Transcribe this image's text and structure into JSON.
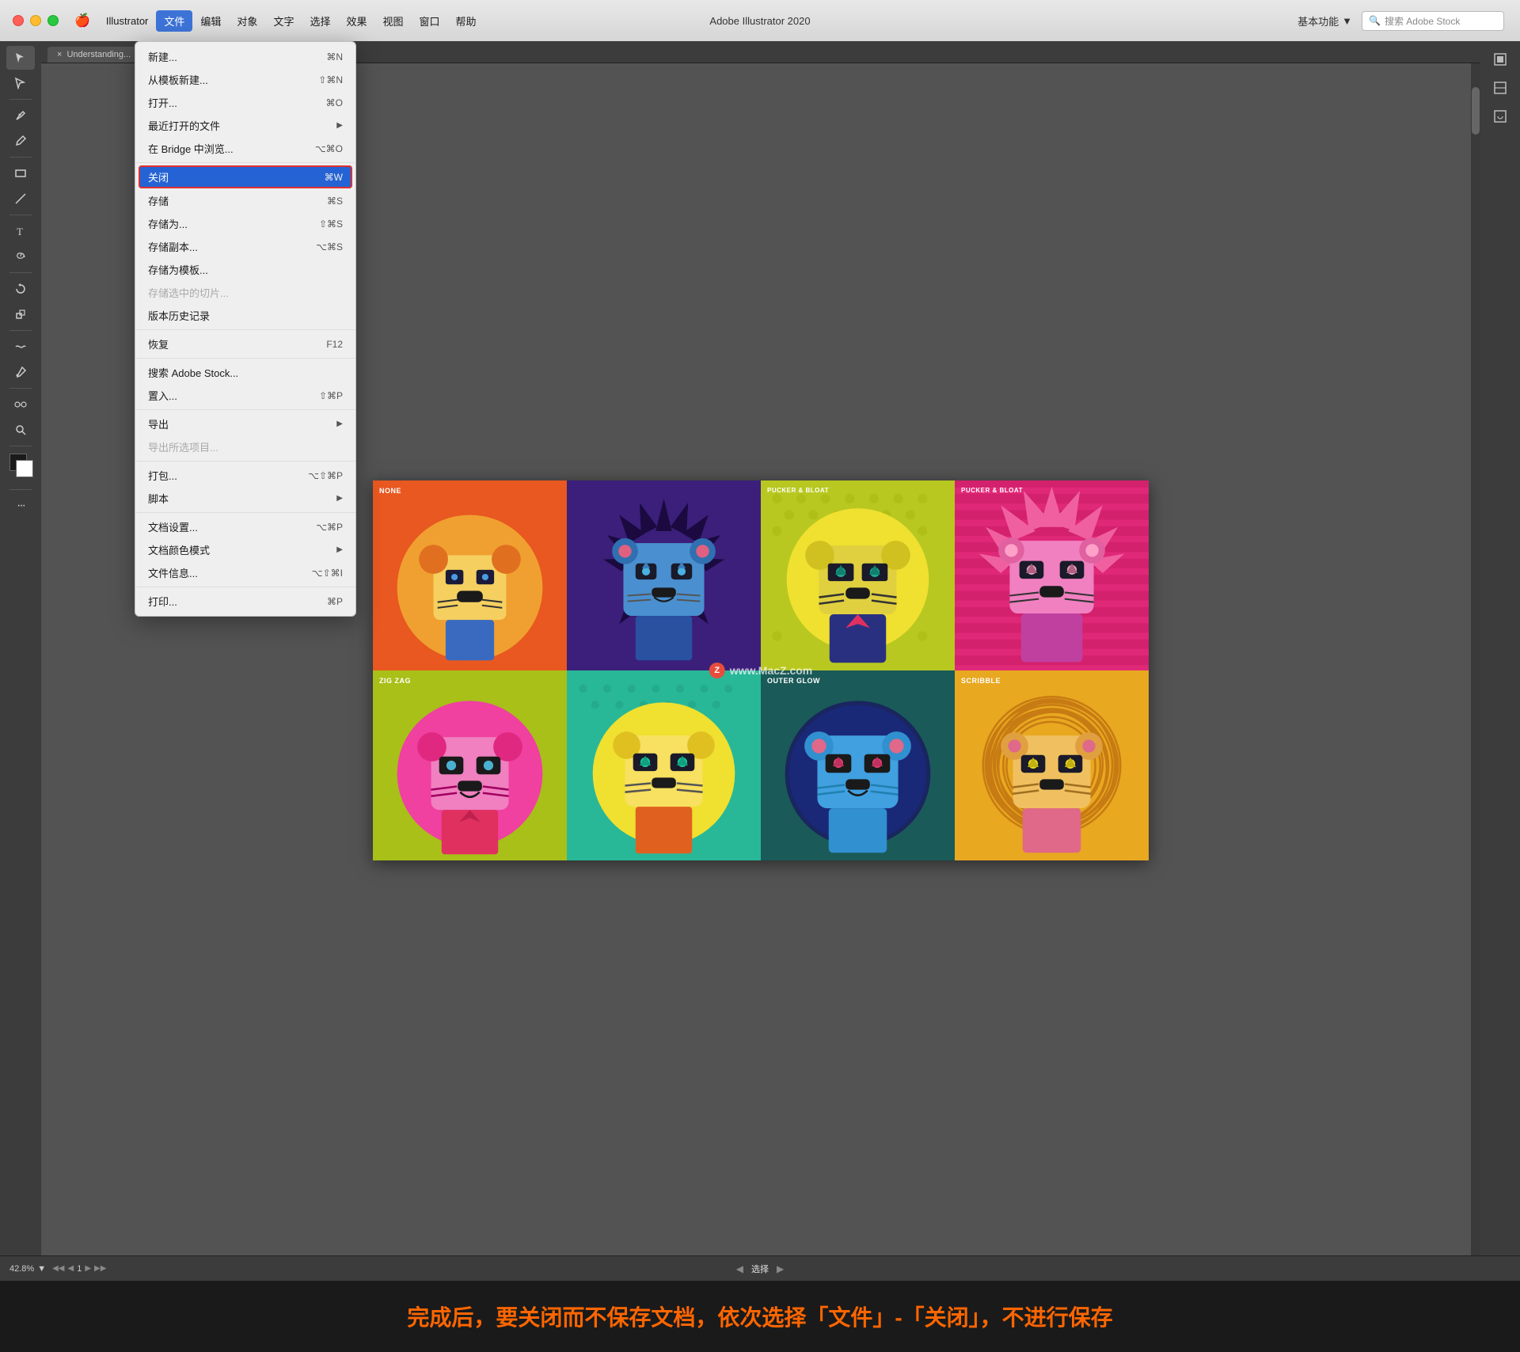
{
  "app": {
    "name": "Illustrator",
    "title": "Adobe Illustrator 2020",
    "apple_menu": "🍎"
  },
  "titlebar": {
    "menus": [
      "Illustrator",
      "文件",
      "编辑",
      "对象",
      "文字",
      "选择",
      "效果",
      "视图",
      "窗口",
      "帮助"
    ],
    "active_menu": "文件",
    "workspace": "基本功能",
    "search_placeholder": "搜索 Adobe Stock"
  },
  "file_menu": {
    "items": [
      {
        "label": "新建...",
        "shortcut": "⌘N",
        "type": "normal"
      },
      {
        "label": "从模板新建...",
        "shortcut": "⇧⌘N",
        "type": "normal"
      },
      {
        "label": "打开...",
        "shortcut": "⌘O",
        "type": "normal"
      },
      {
        "label": "最近打开的文件",
        "shortcut": "",
        "type": "submenu"
      },
      {
        "label": "在 Bridge 中浏览...",
        "shortcut": "⌥⌘O",
        "type": "normal"
      },
      {
        "label": "",
        "type": "separator"
      },
      {
        "label": "关闭",
        "shortcut": "⌘W",
        "type": "highlighted"
      },
      {
        "label": "存储",
        "shortcut": "⌘S",
        "type": "normal"
      },
      {
        "label": "存储为...",
        "shortcut": "⇧⌘S",
        "type": "normal"
      },
      {
        "label": "存储副本...",
        "shortcut": "⌥⌘S",
        "type": "normal"
      },
      {
        "label": "存储为模板...",
        "shortcut": "",
        "type": "normal"
      },
      {
        "label": "存储选中的切片...",
        "shortcut": "",
        "type": "disabled"
      },
      {
        "label": "版本历史记录",
        "shortcut": "",
        "type": "normal"
      },
      {
        "label": "",
        "type": "separator"
      },
      {
        "label": "恢复",
        "shortcut": "F12",
        "type": "normal"
      },
      {
        "label": "",
        "type": "separator"
      },
      {
        "label": "搜索 Adobe Stock...",
        "shortcut": "",
        "type": "normal"
      },
      {
        "label": "置入...",
        "shortcut": "⇧⌘P",
        "type": "normal"
      },
      {
        "label": "",
        "type": "separator"
      },
      {
        "label": "导出",
        "shortcut": "",
        "type": "submenu"
      },
      {
        "label": "导出所选项目...",
        "shortcut": "",
        "type": "disabled"
      },
      {
        "label": "",
        "type": "separator"
      },
      {
        "label": "打包...",
        "shortcut": "⌥⇧⌘P",
        "type": "normal"
      },
      {
        "label": "脚本",
        "shortcut": "",
        "type": "submenu"
      },
      {
        "label": "",
        "type": "separator"
      },
      {
        "label": "文档设置...",
        "shortcut": "⌥⌘P",
        "type": "normal"
      },
      {
        "label": "文档颜色模式",
        "shortcut": "",
        "type": "submenu"
      },
      {
        "label": "文件信息...",
        "shortcut": "⌥⇧⌘I",
        "type": "normal"
      },
      {
        "label": "",
        "type": "separator"
      },
      {
        "label": "打印...",
        "shortcut": "⌘P",
        "type": "normal"
      }
    ]
  },
  "doc_tab": {
    "name": "Understanding...",
    "close": "×"
  },
  "canvas": {
    "watermark": "www.MacZ.com"
  },
  "lion_cells": [
    {
      "id": "none",
      "label": "NONE",
      "bg": "#e85820",
      "label_color": "#fff"
    },
    {
      "id": "none2",
      "label": "",
      "bg": "#3b1f7a",
      "label_color": "#fff"
    },
    {
      "id": "pucker1",
      "label": "PUCKER & BLOAT",
      "bg": "#b8c820",
      "label_color": "#fff"
    },
    {
      "id": "pucker2",
      "label": "PUCKER & BLOAT",
      "bg": "#e02878",
      "label_color": "#fff"
    },
    {
      "id": "zigzag",
      "label": "ZIG ZAG",
      "bg": "#a8c018",
      "label_color": "#fff"
    },
    {
      "id": "zigzag2",
      "label": "",
      "bg": "#28b898",
      "label_color": "#fff"
    },
    {
      "id": "outer",
      "label": "OUTER GLOW",
      "bg": "#1a5a58",
      "label_color": "#fff"
    },
    {
      "id": "scribble",
      "label": "SCRIBBLE",
      "bg": "#e8a820",
      "label_color": "#fff"
    }
  ],
  "statusbar": {
    "zoom": "42.8%",
    "zoom_chevron": "▼",
    "page": "1",
    "status": "选择",
    "nav_prev_prev": "◀◀",
    "nav_prev": "◀",
    "nav_next": "▶",
    "nav_next_next": "▶▶"
  },
  "instruction": {
    "text": "完成后，要关闭而不保存文档，依次选择「文件」-「关闭」，不进行保存"
  },
  "tools": [
    {
      "name": "select",
      "icon": "↖"
    },
    {
      "name": "direct-select",
      "icon": "↗"
    },
    {
      "name": "pen",
      "icon": "✒"
    },
    {
      "name": "pencil",
      "icon": "✏"
    },
    {
      "name": "rectangle",
      "icon": "▭"
    },
    {
      "name": "line",
      "icon": "/"
    },
    {
      "name": "text",
      "icon": "T"
    },
    {
      "name": "spiral",
      "icon": "↺"
    },
    {
      "name": "rotate",
      "icon": "↻"
    },
    {
      "name": "scale",
      "icon": "⤡"
    },
    {
      "name": "warp",
      "icon": "≋"
    },
    {
      "name": "eyedropper",
      "icon": "✦"
    },
    {
      "name": "blend",
      "icon": "◈"
    },
    {
      "name": "more",
      "icon": "..."
    }
  ]
}
